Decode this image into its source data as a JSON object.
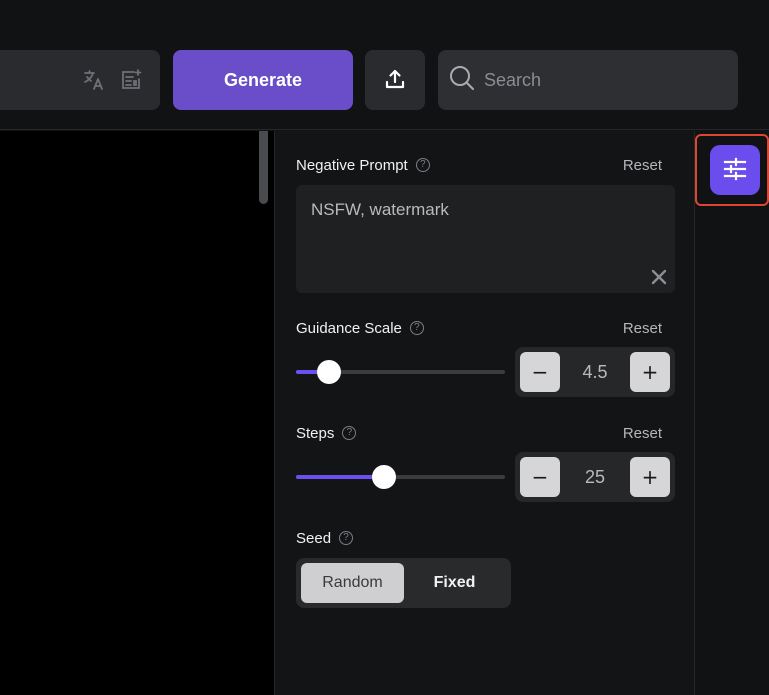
{
  "topbar": {
    "icons": {
      "translate": "translate-icon",
      "template": "template-add-icon",
      "upload": "upload-icon",
      "search": "search-icon"
    },
    "generate_label": "Generate",
    "search": {
      "placeholder": "Search",
      "value": ""
    }
  },
  "panel": {
    "negative_prompt": {
      "label": "Negative Prompt",
      "help": "?",
      "reset_label": "Reset",
      "value": "NSFW, watermark"
    },
    "guidance_scale": {
      "label": "Guidance Scale",
      "help": "?",
      "reset_label": "Reset",
      "value": "4.5",
      "slider_fraction": 0.16,
      "minus": "−",
      "plus": "+"
    },
    "steps": {
      "label": "Steps",
      "help": "?",
      "reset_label": "Reset",
      "value": "25",
      "slider_fraction": 0.42,
      "minus": "−",
      "plus": "+"
    },
    "seed": {
      "label": "Seed",
      "help": "?",
      "options": [
        "Random",
        "Fixed"
      ],
      "selected": "Random"
    }
  },
  "rail": {
    "settings_icon": "sliders-icon"
  },
  "colors": {
    "accent": "#6a4dc8",
    "accent_bright": "#6b4ff0",
    "highlight": "#e0452f",
    "background": "#111214"
  }
}
